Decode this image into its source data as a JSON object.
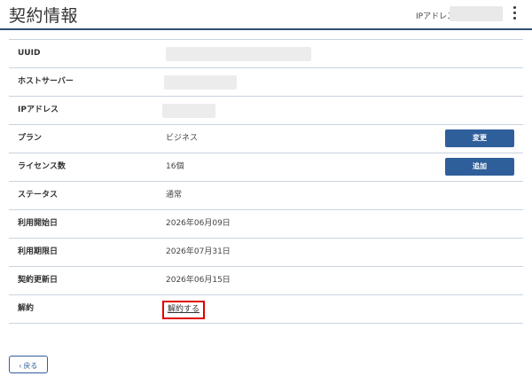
{
  "header": {
    "title": "契約情報",
    "ip_label": "IPアドレス",
    "menu_icon": "kebab-menu-icon"
  },
  "rows": {
    "uuid": {
      "label": "UUID"
    },
    "host": {
      "label": "ホストサーバー"
    },
    "ip": {
      "label": "IPアドレス"
    },
    "plan": {
      "label": "プラン",
      "value": "ビジネス",
      "button": "変更"
    },
    "license": {
      "label": "ライセンス数",
      "value": "16個",
      "button": "追加"
    },
    "status": {
      "label": "ステータス",
      "value": "通常"
    },
    "start": {
      "label": "利用開始日",
      "value": "2026年06月09日"
    },
    "expire": {
      "label": "利用期限日",
      "value": "2026年07月31日"
    },
    "renewal": {
      "label": "契約更新日",
      "value": "2026年06月15日"
    },
    "cancel": {
      "label": "解約",
      "link": "解約する"
    }
  },
  "footer": {
    "back_label": "‹ 戻る"
  },
  "colors": {
    "accent": "#2f5f9a",
    "highlight": "#e00000",
    "divider": "#c9d3de"
  }
}
